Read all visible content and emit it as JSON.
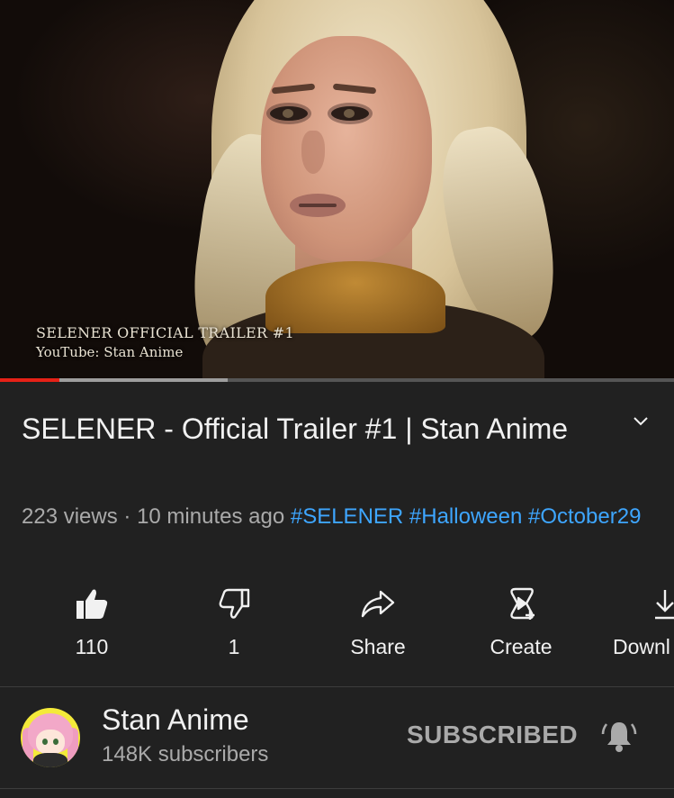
{
  "video": {
    "overlay_line1": "SELENER OFFICIAL TRAILER #1",
    "overlay_line2": "YouTube: Stan Anime",
    "progress_played_fraction": 0.088,
    "progress_buffered_fraction": 0.338
  },
  "info": {
    "title": "SELENER - Official Trailer #1 | Stan Anime",
    "views": "223 views",
    "separator": " · ",
    "time_ago": "10 minutes ago",
    "hashtags": [
      "#SELENER",
      "#Halloween",
      "#October29"
    ],
    "expand_icon": "chevron-down-icon"
  },
  "actions": {
    "like": {
      "label": "110",
      "icon": "thumbs-up-icon"
    },
    "dislike": {
      "label": "1",
      "icon": "thumbs-down-icon"
    },
    "share": {
      "label": "Share",
      "icon": "share-arrow-icon"
    },
    "create": {
      "label": "Create",
      "icon": "create-icon"
    },
    "download": {
      "label": "Downl",
      "icon": "download-icon"
    }
  },
  "channel": {
    "name": "Stan Anime",
    "subscribers": "148K subscribers",
    "subscribe_label": "SUBSCRIBED",
    "bell_icon": "bell-icon"
  },
  "colors": {
    "background": "#212121",
    "hashtag": "#3ea6ff",
    "progress_played": "#e62117",
    "secondary_text": "#aaaaaa"
  }
}
